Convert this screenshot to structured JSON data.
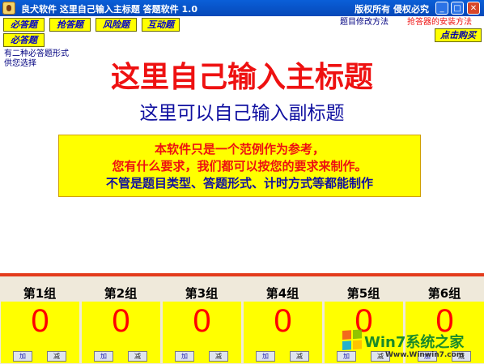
{
  "titlebar": {
    "title": "良犬软件  这里自己输入主标题   答题软件 1.0",
    "right_text": "版权所有  侵权必究",
    "minimize": "_",
    "maximize": "□",
    "close": "✕"
  },
  "menu": {
    "buttons": [
      "必答题",
      "抢答题",
      "风险题",
      "互动题"
    ],
    "second_row": "必答题"
  },
  "note": "有二种必答题形式供您选择",
  "links": {
    "edit_method": "题目修改方法",
    "install_method": "抢答器的安装方法"
  },
  "buy_button": "点击购买",
  "main_title": "这里自己输入主标题",
  "sub_title": "这里可以自己输入副标题",
  "info": {
    "line1": "本软件只是一个范例作为参考，",
    "line2": "您有什么要求，我们都可以按您的要求来制作。",
    "line3": "不管是题目类型、答题形式、计时方式等都能制作"
  },
  "groups": [
    {
      "name": "第1组",
      "score": "0",
      "add": "加",
      "sub": "减"
    },
    {
      "name": "第2组",
      "score": "0",
      "add": "加",
      "sub": "减"
    },
    {
      "name": "第3组",
      "score": "0",
      "add": "加",
      "sub": "减"
    },
    {
      "name": "第4组",
      "score": "0",
      "add": "加",
      "sub": "减"
    },
    {
      "name": "第5组",
      "score": "0",
      "add": "加",
      "sub": "减"
    },
    {
      "name": "第6组",
      "score": "0",
      "add": "加",
      "sub": "减"
    }
  ],
  "watermark": {
    "title": "Win7系统之家",
    "url": "Www.Winwin7.com"
  },
  "colors": {
    "title_red": "#ee1111",
    "subtitle_blue": "#1010a0",
    "highlight_yellow": "#ffff00",
    "accent_bar": "#e33b1b"
  }
}
